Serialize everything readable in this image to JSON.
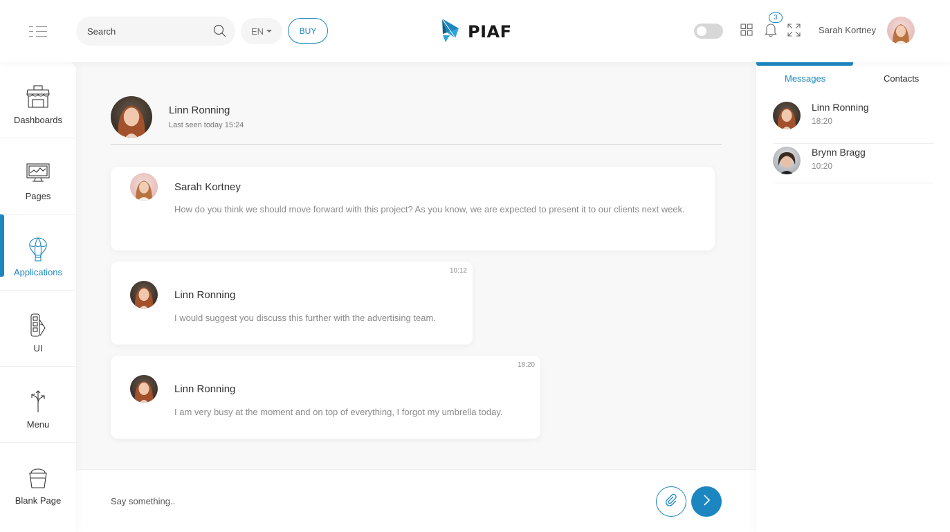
{
  "header": {
    "search_placeholder": "Search",
    "language": "EN",
    "buy_label": "BUY",
    "logo_text": "PIAF",
    "notification_count": "3",
    "user_name": "Sarah Kortney"
  },
  "sidebar": {
    "items": [
      {
        "label": "Dashboards",
        "icon": "storefront-icon"
      },
      {
        "label": "Pages",
        "icon": "monitor-icon"
      },
      {
        "label": "Applications",
        "icon": "air-balloon-icon",
        "active": true
      },
      {
        "label": "UI",
        "icon": "color-swatch-icon"
      },
      {
        "label": "Menu",
        "icon": "split-arrows-icon"
      },
      {
        "label": "Blank Page",
        "icon": "bucket-icon"
      }
    ]
  },
  "chat": {
    "contact_name": "Linn Ronning",
    "last_seen": "Last seen today 15:24",
    "messages": [
      {
        "sender": "Sarah Kortney",
        "text": "How do you think we should move forward with this project? As you know, we are expected to present it to our clients next week.",
        "time": ""
      },
      {
        "sender": "Linn Ronning",
        "text": "I would suggest you discuss this further with the advertising team.",
        "time": "10:12"
      },
      {
        "sender": "Linn Ronning",
        "text": "I am very busy at the moment and on top of everything, I forgot my umbrella today.",
        "time": "18:20"
      }
    ],
    "composer_placeholder": "Say something.."
  },
  "right_panel": {
    "tabs": [
      "Messages",
      "Contacts"
    ],
    "active_tab": "Messages",
    "conversations": [
      {
        "name": "Linn Ronning",
        "time": "18:20"
      },
      {
        "name": "Brynn Bragg",
        "time": "10:20"
      }
    ]
  },
  "colors": {
    "accent": "#1c86c0",
    "background": "#f8f8f8",
    "surface": "#ffffff"
  }
}
